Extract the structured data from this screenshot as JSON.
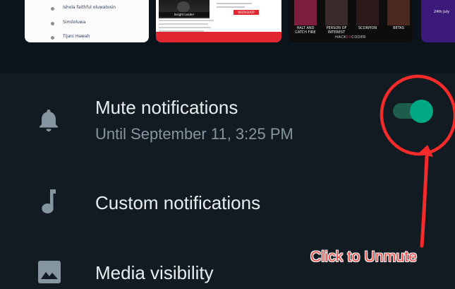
{
  "media": {
    "thumb1_items": [
      "Ishola faithful oluwatosin",
      "Similoluwa",
      "Tijani Hawah"
    ],
    "thumb2_namebar": "Insight Leader",
    "thumb2_badge": "WORKSHOP",
    "thumb3_posters": [
      {
        "caption": "HALT AND CATCH FIRE",
        "color": "#7c1d3b"
      },
      {
        "caption": "PERSON OF INTEREST",
        "color": "#3a2b2b"
      },
      {
        "caption": "SCORPION",
        "color": "#2c1a1a"
      },
      {
        "caption": "BETAS",
        "color": "#4a2a20"
      }
    ],
    "thumb3_brand_prefix": "HACK",
    "thumb3_brand_mid": "ER",
    "thumb3_brand_suffix": "CODER",
    "thumb4_text": "24th July"
  },
  "settings": {
    "mute": {
      "icon": "bell-icon",
      "title": "Mute notifications",
      "subtitle": "Until September 11, 3:25 PM",
      "toggle_on": true
    },
    "custom": {
      "icon": "music-note-icon",
      "title": "Custom notifications"
    },
    "media": {
      "icon": "image-icon",
      "title": "Media visibility"
    }
  },
  "annotation": {
    "text": "Click to Unmute",
    "color": "#f54646"
  },
  "colors": {
    "background": "#111b21",
    "accent": "#00a884",
    "title_text": "#e9edef",
    "subtitle_text": "#8696a0"
  }
}
